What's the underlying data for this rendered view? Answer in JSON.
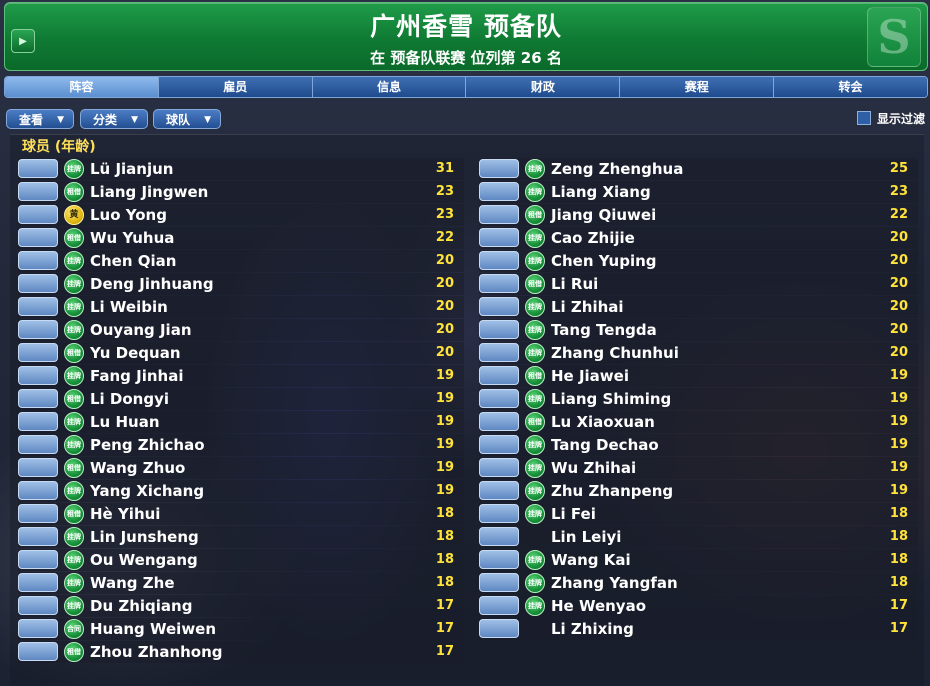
{
  "header": {
    "title": "广州香雪 预备队",
    "subtitle": "在 预备队联赛 位列第 26 名",
    "logo_letter": "S"
  },
  "tabs": [
    {
      "label": "阵容",
      "active": true
    },
    {
      "label": "雇员",
      "active": false
    },
    {
      "label": "信息",
      "active": false
    },
    {
      "label": "财政",
      "active": false
    },
    {
      "label": "赛程",
      "active": false
    },
    {
      "label": "转会",
      "active": false
    }
  ],
  "toolbar": {
    "view_label": "查看",
    "sort_label": "分类",
    "team_label": "球队",
    "filter_label": "显示过滤"
  },
  "list_title": "球员 (年龄)",
  "players_left": [
    {
      "name": "Lü Jianjun",
      "age": "31",
      "status": "挂牌"
    },
    {
      "name": "Liang Jingwen",
      "age": "23",
      "status": "租借"
    },
    {
      "name": "Luo Yong",
      "age": "23",
      "status": "黄",
      "status_color": "yellow"
    },
    {
      "name": "Wu Yuhua",
      "age": "22",
      "status": "租借"
    },
    {
      "name": "Chen Qian",
      "age": "20",
      "status": "挂牌"
    },
    {
      "name": "Deng Jinhuang",
      "age": "20",
      "status": "挂牌"
    },
    {
      "name": "Li Weibin",
      "age": "20",
      "status": "挂牌"
    },
    {
      "name": "Ouyang Jian",
      "age": "20",
      "status": "挂牌"
    },
    {
      "name": "Yu Dequan",
      "age": "20",
      "status": "租借"
    },
    {
      "name": "Fang Jinhai",
      "age": "19",
      "status": "挂牌"
    },
    {
      "name": "Li Dongyi",
      "age": "19",
      "status": "租借"
    },
    {
      "name": "Lu Huan",
      "age": "19",
      "status": "挂牌"
    },
    {
      "name": "Peng Zhichao",
      "age": "19",
      "status": "挂牌"
    },
    {
      "name": "Wang Zhuo",
      "age": "19",
      "status": "租借"
    },
    {
      "name": "Yang Xichang",
      "age": "19",
      "status": "挂牌"
    },
    {
      "name": "Hè Yihui",
      "age": "18",
      "status": "租借"
    },
    {
      "name": "Lin Junsheng",
      "age": "18",
      "status": "挂牌"
    },
    {
      "name": "Ou Wengang",
      "age": "18",
      "status": "挂牌"
    },
    {
      "name": "Wang Zhe",
      "age": "18",
      "status": "挂牌"
    },
    {
      "name": "Du Zhiqiang",
      "age": "17",
      "status": "挂牌"
    },
    {
      "name": "Huang Weiwen",
      "age": "17",
      "status": "合同"
    },
    {
      "name": "Zhou Zhanhong",
      "age": "17",
      "status": "租借"
    }
  ],
  "players_right": [
    {
      "name": "Zeng Zhenghua",
      "age": "25",
      "status": "挂牌"
    },
    {
      "name": "Liang Xiang",
      "age": "23",
      "status": "挂牌"
    },
    {
      "name": "Jiang Qiuwei",
      "age": "22",
      "status": "租借"
    },
    {
      "name": "Cao Zhijie",
      "age": "20",
      "status": "挂牌"
    },
    {
      "name": "Chen Yuping",
      "age": "20",
      "status": "挂牌"
    },
    {
      "name": "Li Rui",
      "age": "20",
      "status": "租借"
    },
    {
      "name": "Li Zhihai",
      "age": "20",
      "status": "挂牌"
    },
    {
      "name": "Tang Tengda",
      "age": "20",
      "status": "挂牌"
    },
    {
      "name": "Zhang Chunhui",
      "age": "20",
      "status": "挂牌"
    },
    {
      "name": "He Jiawei",
      "age": "19",
      "status": "租借"
    },
    {
      "name": "Liang Shiming",
      "age": "19",
      "status": "挂牌"
    },
    {
      "name": "Lu Xiaoxuan",
      "age": "19",
      "status": "租借"
    },
    {
      "name": "Tang Dechao",
      "age": "19",
      "status": "挂牌"
    },
    {
      "name": "Wu Zhihai",
      "age": "19",
      "status": "挂牌"
    },
    {
      "name": "Zhu Zhanpeng",
      "age": "19",
      "status": "挂牌"
    },
    {
      "name": "Li Fei",
      "age": "18",
      "status": "挂牌"
    },
    {
      "name": "Lin Leiyi",
      "age": "18",
      "status": ""
    },
    {
      "name": "Wang Kai",
      "age": "18",
      "status": "挂牌"
    },
    {
      "name": "Zhang Yangfan",
      "age": "18",
      "status": "挂牌"
    },
    {
      "name": "He Wenyao",
      "age": "17",
      "status": "挂牌"
    },
    {
      "name": "Li Zhixing",
      "age": "17",
      "status": ""
    }
  ],
  "icons": {
    "header_button": "play-arrow-icon",
    "dropdown": "triangle-down-icon",
    "status_badge": "status-circle-icon"
  },
  "colors": {
    "header_green": "#0f7a33",
    "tab_blue": "#1e4b8d",
    "active_tab": "#5a8fd0",
    "age_yellow": "#ffe23a",
    "title_yellow": "#ffe05a"
  }
}
